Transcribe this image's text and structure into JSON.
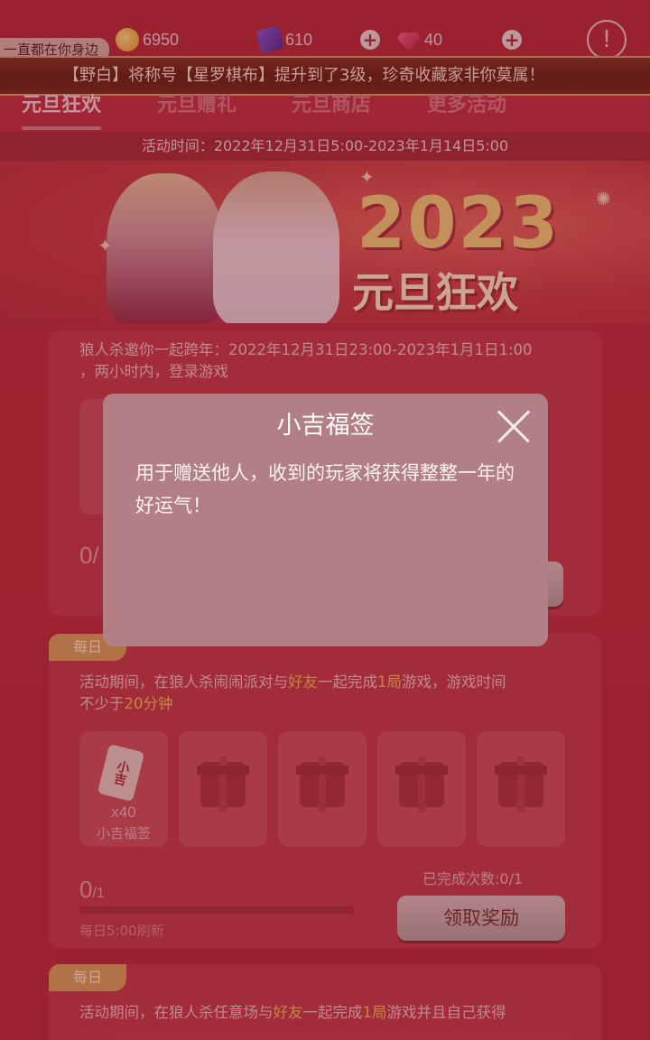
{
  "top": {
    "coins": "6950",
    "cards": "610",
    "gems": "40",
    "subtitle": "一直都在你身边"
  },
  "marquee": "【野白】将称号【星罗棋布】提升到了3级，珍奇收藏家非你莫属！",
  "tabs": [
    "元旦狂欢",
    "元旦赠礼",
    "元旦商店",
    "更多活动"
  ],
  "activity_time": "活动时间：2022年12月31日5:00-2023年1月14日5:00",
  "banner": {
    "year": "2023",
    "title": "元旦狂欢"
  },
  "task1": {
    "desc_line1": "狼人杀邀你一起跨年：2022年12月31日23:00-2023年1月1日1:00",
    "desc_line2": "，两小时内，登录游戏",
    "progress": "0/"
  },
  "task2": {
    "tag": "每日",
    "desc_a": "活动期间，在狼人杀闹闹派对与",
    "desc_friend": "好友",
    "desc_b": "一起完成",
    "desc_round": "1局",
    "desc_c": "游戏，游戏时间",
    "desc_line2a": "不少于",
    "desc_minutes": "20分钟",
    "reward_qty": "x40",
    "reward_name": "小吉福签",
    "reward_icon_text": "小吉",
    "progress_num": "0",
    "progress_den": "/1",
    "done": "已完成次数:0/1",
    "claim": "领取奖励",
    "refresh": "每日5:00刷新"
  },
  "task3": {
    "tag": "每日",
    "desc_a": "活动期间，在狼人杀任意场与",
    "desc_friend": "好友",
    "desc_b": "一起完成",
    "desc_round": "1局",
    "desc_c": "游戏并且自己获得"
  },
  "modal": {
    "title": "小吉福签",
    "body": "用于赠送他人，收到的玩家将获得整整一年的好运气！"
  }
}
